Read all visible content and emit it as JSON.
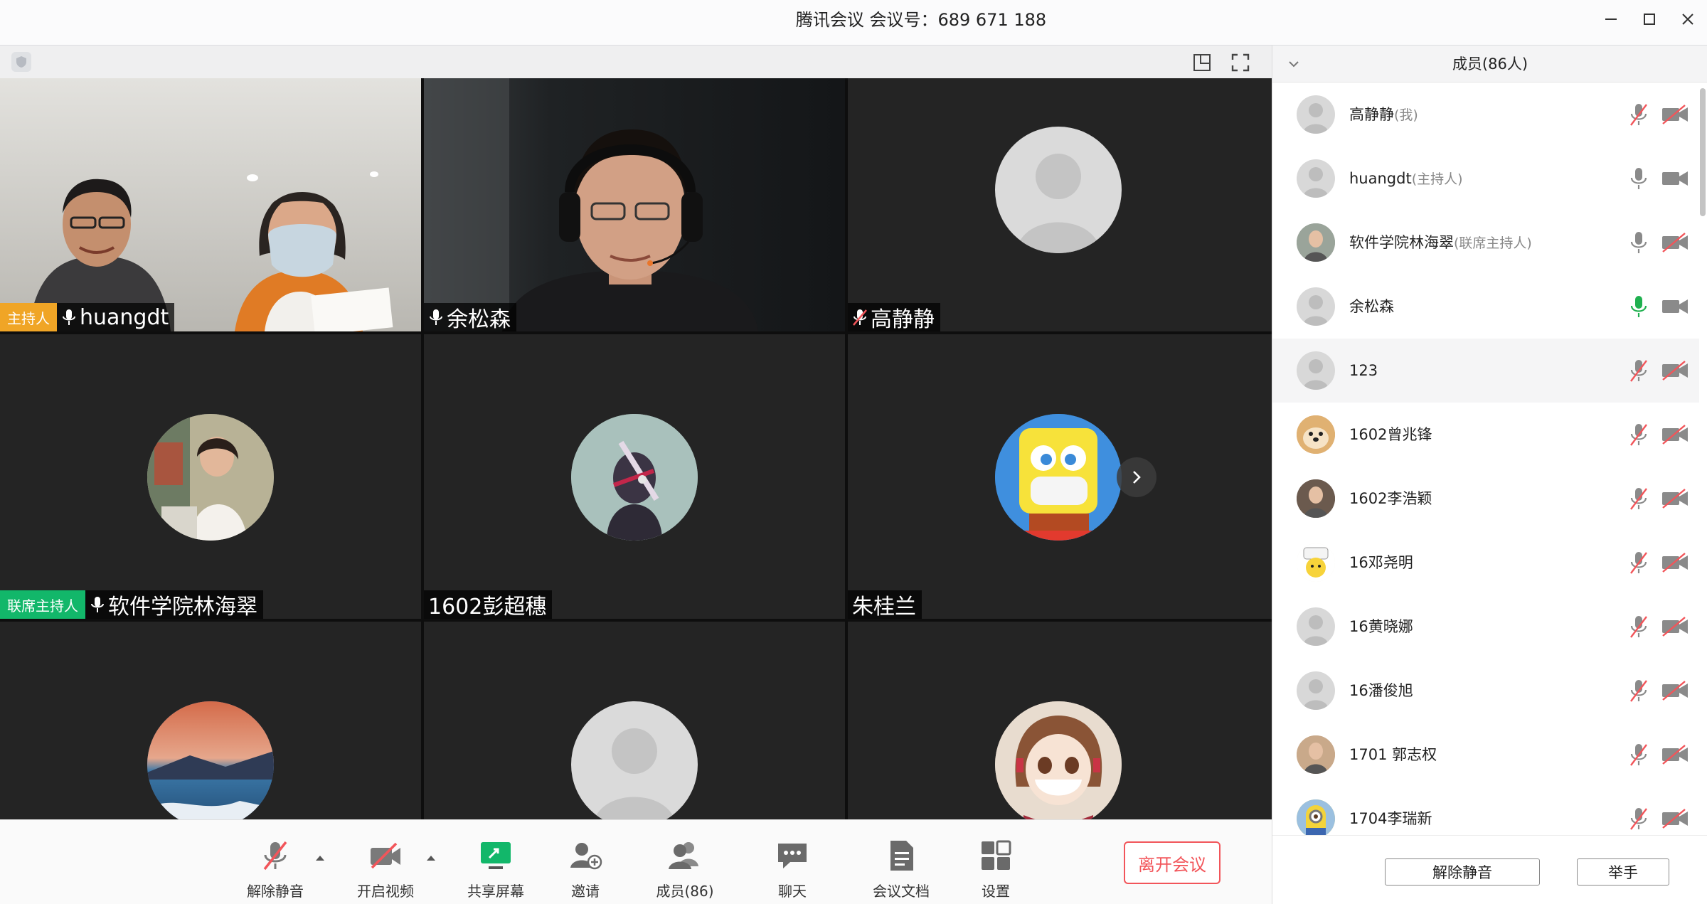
{
  "window": {
    "title": "腾讯会议 会议号：689 671 188"
  },
  "video_tiles": [
    {
      "role": "主持人",
      "name": "huangdt",
      "mic": "on"
    },
    {
      "role": "",
      "name": "余松森",
      "mic": "on"
    },
    {
      "role": "",
      "name": "高静静",
      "mic": "muted"
    },
    {
      "role": "联席主持人",
      "name": "软件学院林海翠",
      "mic": "on"
    },
    {
      "role": "",
      "name": "1602彭超穗",
      "mic": "none"
    },
    {
      "role": "",
      "name": "朱桂兰",
      "mic": "none"
    },
    {
      "role": "",
      "name": "",
      "mic": "none"
    },
    {
      "role": "",
      "name": "",
      "mic": "none"
    },
    {
      "role": "",
      "name": "",
      "mic": "none"
    }
  ],
  "toolbar": {
    "unmute": "解除静音",
    "start_video": "开启视频",
    "share_screen": "共享屏幕",
    "invite": "邀请",
    "members": "成员(86)",
    "chat": "聊天",
    "docs": "会议文档",
    "settings": "设置",
    "leave": "离开会议"
  },
  "panel": {
    "title": "成员(86人)",
    "members": [
      {
        "name": "高静静",
        "role": "(我)",
        "mic": "muted",
        "cam": "off"
      },
      {
        "name": "huangdt",
        "role": "(主持人)",
        "mic": "on",
        "cam": "on"
      },
      {
        "name": "软件学院林海翠",
        "role": "(联席主持人)",
        "mic": "on",
        "cam": "off"
      },
      {
        "name": "余松森",
        "role": "",
        "mic": "speaking",
        "cam": "on"
      },
      {
        "name": "123",
        "role": "",
        "mic": "muted",
        "cam": "off"
      },
      {
        "name": "1602曾兆锋",
        "role": "",
        "mic": "muted",
        "cam": "off"
      },
      {
        "name": "1602李浩颖",
        "role": "",
        "mic": "muted",
        "cam": "off"
      },
      {
        "name": "16邓尧明",
        "role": "",
        "mic": "muted",
        "cam": "off"
      },
      {
        "name": "16黄晓娜",
        "role": "",
        "mic": "muted",
        "cam": "off"
      },
      {
        "name": "16潘俊旭",
        "role": "",
        "mic": "muted",
        "cam": "off"
      },
      {
        "name": "1701 郭志权",
        "role": "",
        "mic": "muted",
        "cam": "off"
      },
      {
        "name": "1704李瑞新",
        "role": "",
        "mic": "muted",
        "cam": "off"
      }
    ],
    "mute_all": "解除静音",
    "raise_hand": "举手"
  },
  "colors": {
    "host_badge": "#f0a526",
    "cohost_badge": "#12b76a",
    "leave": "#f2555a",
    "muted": "#f2555a",
    "speaking": "#1fb04f",
    "share": "#12b76a"
  }
}
